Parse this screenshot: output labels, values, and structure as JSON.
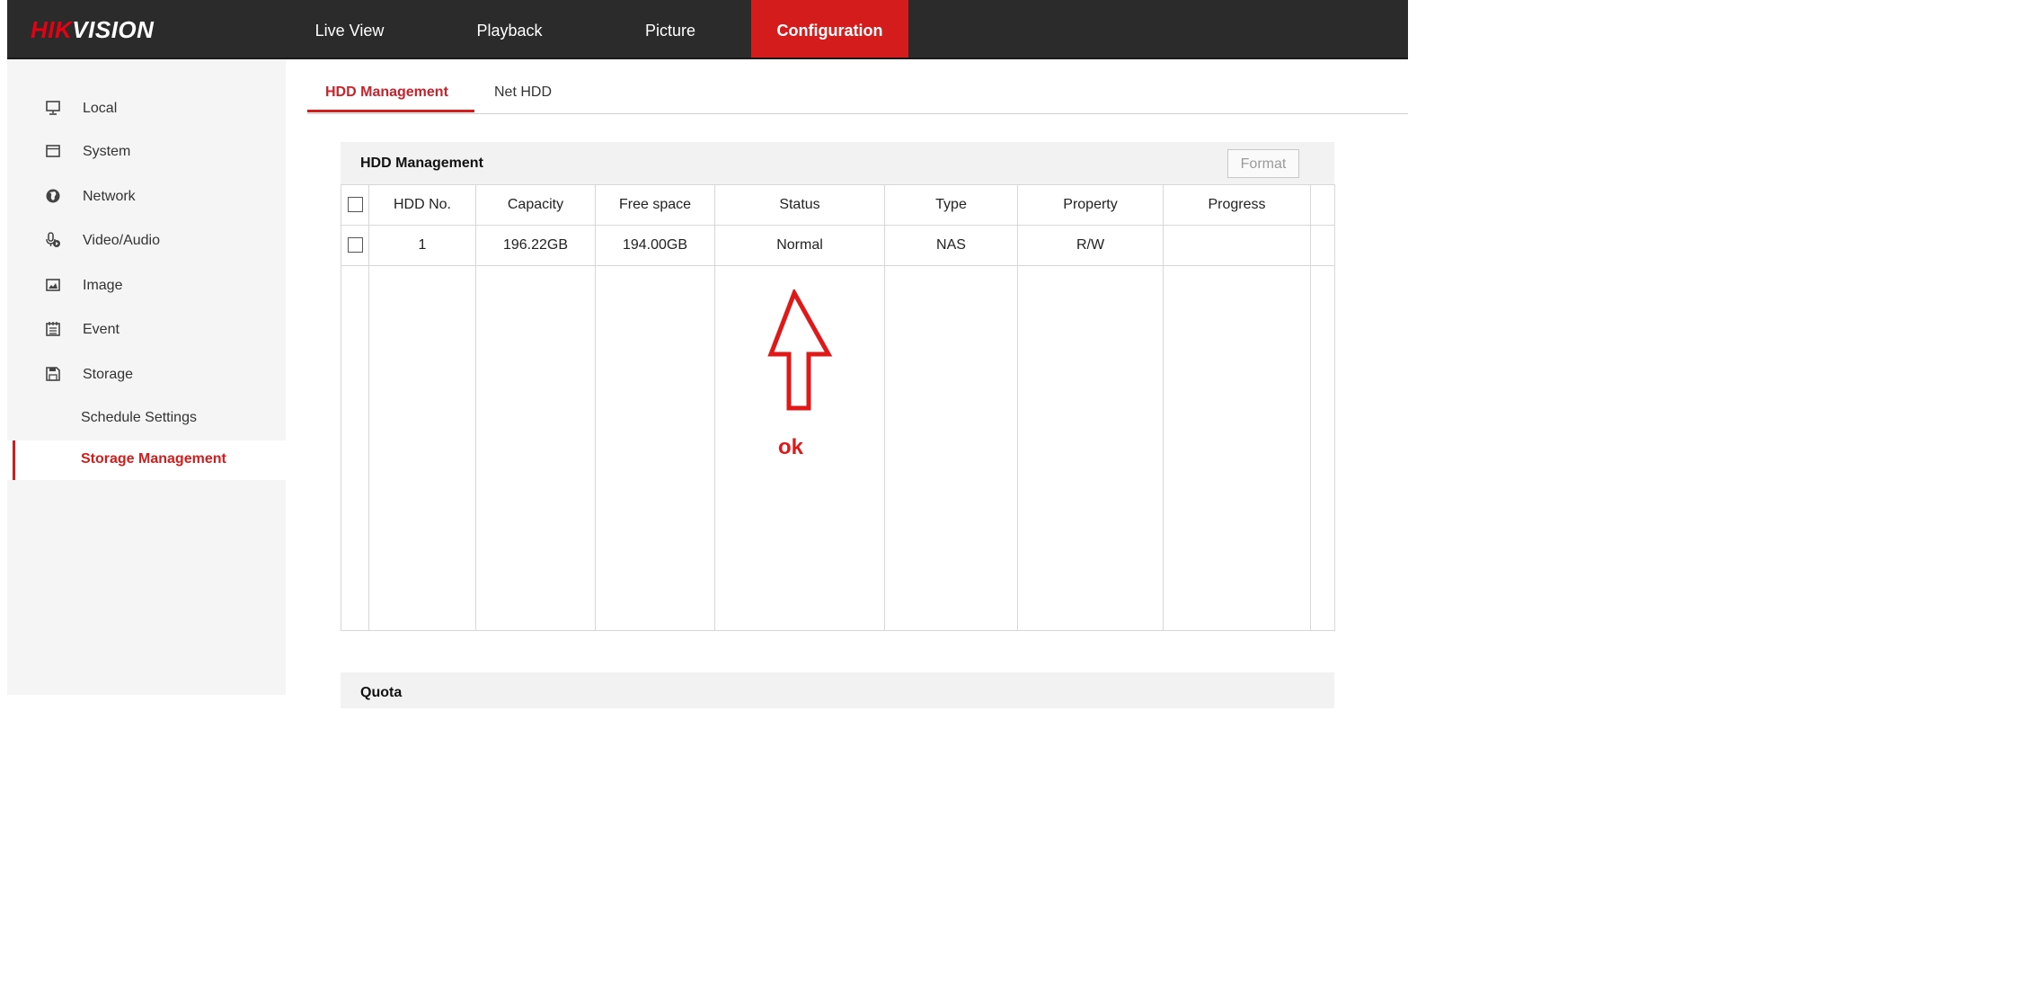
{
  "app": {
    "logo_red": "HIK",
    "logo_white": "VISION"
  },
  "topnav": [
    {
      "label": "Live View",
      "active": false
    },
    {
      "label": "Playback",
      "active": false
    },
    {
      "label": "Picture",
      "active": false
    },
    {
      "label": "Configuration",
      "active": true
    }
  ],
  "sidebar": {
    "items": [
      {
        "label": "Local",
        "icon": "monitor-icon"
      },
      {
        "label": "System",
        "icon": "window-icon"
      },
      {
        "label": "Network",
        "icon": "globe-icon"
      },
      {
        "label": "Video/Audio",
        "icon": "microphone-icon"
      },
      {
        "label": "Image",
        "icon": "image-icon"
      },
      {
        "label": "Event",
        "icon": "calendar-icon"
      },
      {
        "label": "Storage",
        "icon": "floppy-disk-icon"
      }
    ],
    "subitems": [
      {
        "label": "Schedule Settings",
        "active": false
      },
      {
        "label": "Storage Management",
        "active": true
      }
    ]
  },
  "tabs": [
    {
      "label": "HDD Management",
      "active": true
    },
    {
      "label": "Net HDD",
      "active": false
    }
  ],
  "hdd_panel": {
    "title": "HDD Management",
    "format_label": "Format",
    "columns": [
      "HDD No.",
      "Capacity",
      "Free space",
      "Status",
      "Type",
      "Property",
      "Progress"
    ],
    "rows": [
      {
        "hdd_no": "1",
        "capacity": "196.22GB",
        "free_space": "194.00GB",
        "status": "Normal",
        "type": "NAS",
        "property": "R/W",
        "progress": ""
      }
    ]
  },
  "annotation": {
    "text": "ok",
    "color": "#e01818"
  },
  "quota": {
    "title": "Quota"
  },
  "colors": {
    "accent": "#d51c1c",
    "topbar": "#2b2b2b"
  }
}
